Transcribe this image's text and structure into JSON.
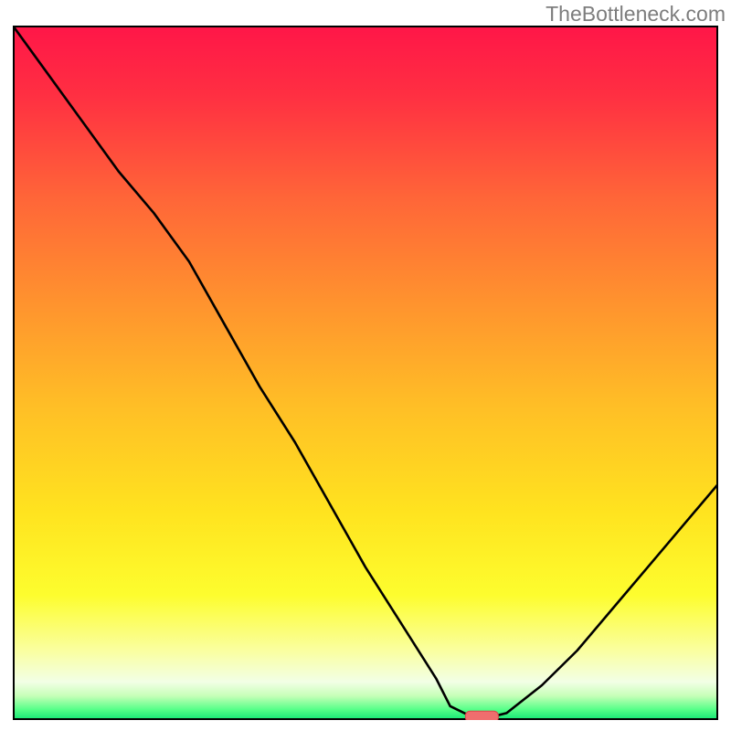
{
  "watermark": "TheBottleneck.com",
  "chart_data": {
    "type": "line",
    "title": "",
    "xlabel": "",
    "ylabel": "",
    "xlim": [
      0,
      100
    ],
    "ylim": [
      0,
      100
    ],
    "x": [
      0,
      5,
      10,
      15,
      20,
      25,
      30,
      35,
      40,
      45,
      50,
      55,
      60,
      62,
      65,
      68,
      70,
      75,
      80,
      85,
      90,
      95,
      100
    ],
    "values": [
      100,
      93,
      86,
      79,
      73,
      66,
      57,
      48,
      40,
      31,
      22,
      14,
      6,
      2,
      0.5,
      0.5,
      1,
      5,
      10,
      16,
      22,
      28,
      34
    ],
    "minimum_marker": {
      "x": 66.5,
      "value": 0.5
    },
    "background_gradient_stops": [
      {
        "pos": 0.0,
        "color": "#ff1648"
      },
      {
        "pos": 0.1,
        "color": "#ff2f42"
      },
      {
        "pos": 0.25,
        "color": "#ff6638"
      },
      {
        "pos": 0.4,
        "color": "#ff932e"
      },
      {
        "pos": 0.55,
        "color": "#ffbf26"
      },
      {
        "pos": 0.7,
        "color": "#ffe31f"
      },
      {
        "pos": 0.82,
        "color": "#fdfd2e"
      },
      {
        "pos": 0.9,
        "color": "#faffa0"
      },
      {
        "pos": 0.945,
        "color": "#f2ffe6"
      },
      {
        "pos": 0.965,
        "color": "#c7ffb8"
      },
      {
        "pos": 0.985,
        "color": "#55ff88"
      },
      {
        "pos": 1.0,
        "color": "#12e574"
      }
    ],
    "line_color": "#000000",
    "line_width": 2.6,
    "marker": {
      "fill": "#ef6e6e",
      "stroke": "#d64a4a"
    }
  }
}
